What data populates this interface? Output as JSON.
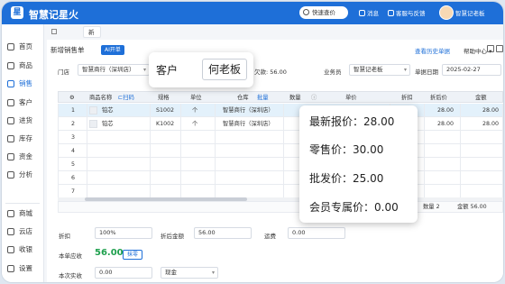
{
  "app": {
    "name": "智慧记星火"
  },
  "topbar": {
    "search": "快速查价",
    "messages": "消息",
    "help_feedback": "客服与反馈",
    "user": "智慧记老板"
  },
  "sidebar": {
    "items": [
      {
        "label": "首页"
      },
      {
        "label": "商品"
      },
      {
        "label": "销售"
      },
      {
        "label": "客户"
      },
      {
        "label": "进货"
      },
      {
        "label": "库存"
      },
      {
        "label": "资金"
      },
      {
        "label": "分析"
      },
      {
        "label": "商城"
      },
      {
        "label": "云店"
      },
      {
        "label": "收银"
      },
      {
        "label": "设置"
      }
    ]
  },
  "tabs": {
    "home": "首页",
    "current": "新增销售单",
    "close": "×"
  },
  "header": {
    "title": "新增销售单",
    "ai_badge": "AI开单",
    "history_link": "查看历史单据",
    "help": "帮助中心"
  },
  "form": {
    "store_label": "门店",
    "store_value": "智慧商行（深圳店）",
    "balance_text": "欠款: 56.00",
    "salesperson_label": "业务员",
    "salesperson_value": "智慧记老板",
    "date_label": "单据日期",
    "date_value": "2025-02-27"
  },
  "table": {
    "headers": {
      "gear": "⚙",
      "name": "商品名称",
      "scan": "扫码",
      "spec": "规格",
      "unit": "单位",
      "warehouse": "仓库",
      "batch": "批量",
      "qty": "数量",
      "price": "单价",
      "discount": "折扣",
      "discounted_price": "折后价",
      "amount": "金额"
    },
    "rows": [
      {
        "no": "1",
        "name": "铂芯",
        "spec": "S1002",
        "unit": "个",
        "warehouse": "智慧商行（深圳店）",
        "discount_price": "28.00",
        "amount": "28.00"
      },
      {
        "no": "2",
        "name": "铂芯",
        "spec": "K1002",
        "unit": "个",
        "warehouse": "智慧商行（深圳店）",
        "discount_price": "28.00",
        "amount": "28.00"
      },
      {
        "no": "3"
      },
      {
        "no": "4"
      },
      {
        "no": "5"
      },
      {
        "no": "6"
      },
      {
        "no": "7"
      },
      {
        "no": "8"
      }
    ],
    "summary": {
      "qty_label": "数量",
      "qty_value": "2",
      "amount_label": "金额",
      "amount_value": "56.00"
    }
  },
  "footer": {
    "discount_label": "折扣",
    "discount_value": "100%",
    "after_discount_label": "折后金额",
    "after_discount_value": "56.00",
    "shipping_label": "运费",
    "shipping_value": "0.00",
    "receivable_label": "本单应收",
    "receivable_value": "56.00",
    "erase_button": "抹零",
    "paid_label": "本次实收",
    "paid_value": "0.00",
    "payment_method": "现金"
  },
  "popup_customer": {
    "label": "客户",
    "value": "何老板"
  },
  "popup_price": {
    "latest": "最新报价：28.00",
    "retail": "零售价：30.00",
    "wholesale": "批发价：25.00",
    "member": "会员专属价：0.00"
  },
  "colors": {
    "primary": "#1e6fd8",
    "amount_green": "#1fa04e"
  }
}
